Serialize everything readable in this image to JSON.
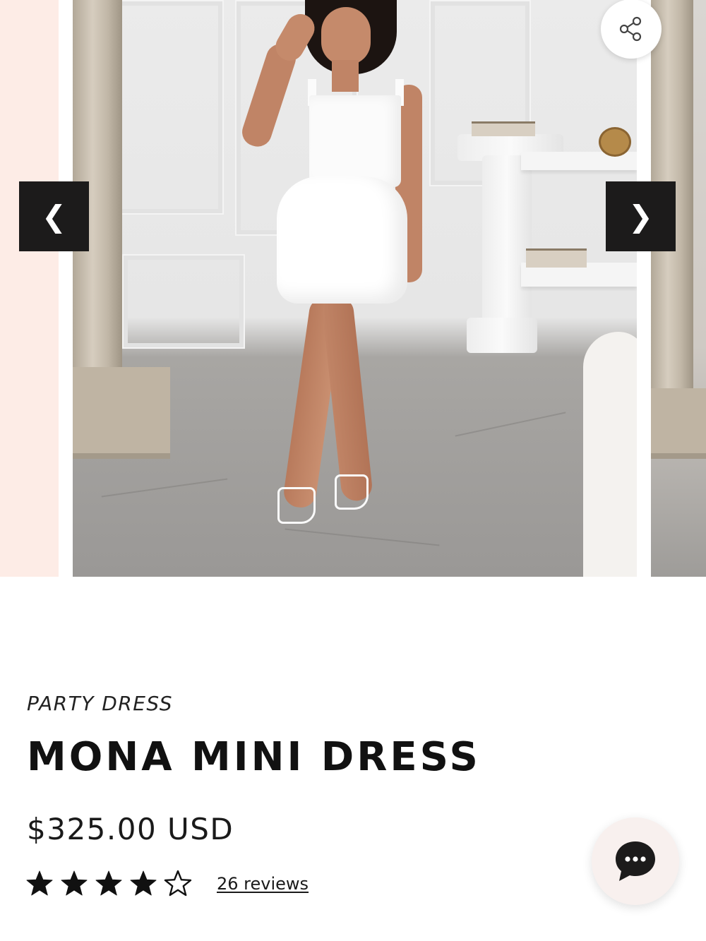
{
  "gallery": {
    "prev_arrow_glyph": "❮",
    "next_arrow_glyph": "❯",
    "share_icon": "share-icon",
    "accent_prev_slide": "#fdece6"
  },
  "product": {
    "category": "PARTY DRESS",
    "title": "MONA MINI DRESS",
    "price": "$325.00 USD",
    "rating": 4,
    "rating_max": 5,
    "reviews_label": "26 reviews"
  },
  "chat": {
    "icon": "chat-bubble-icon"
  }
}
